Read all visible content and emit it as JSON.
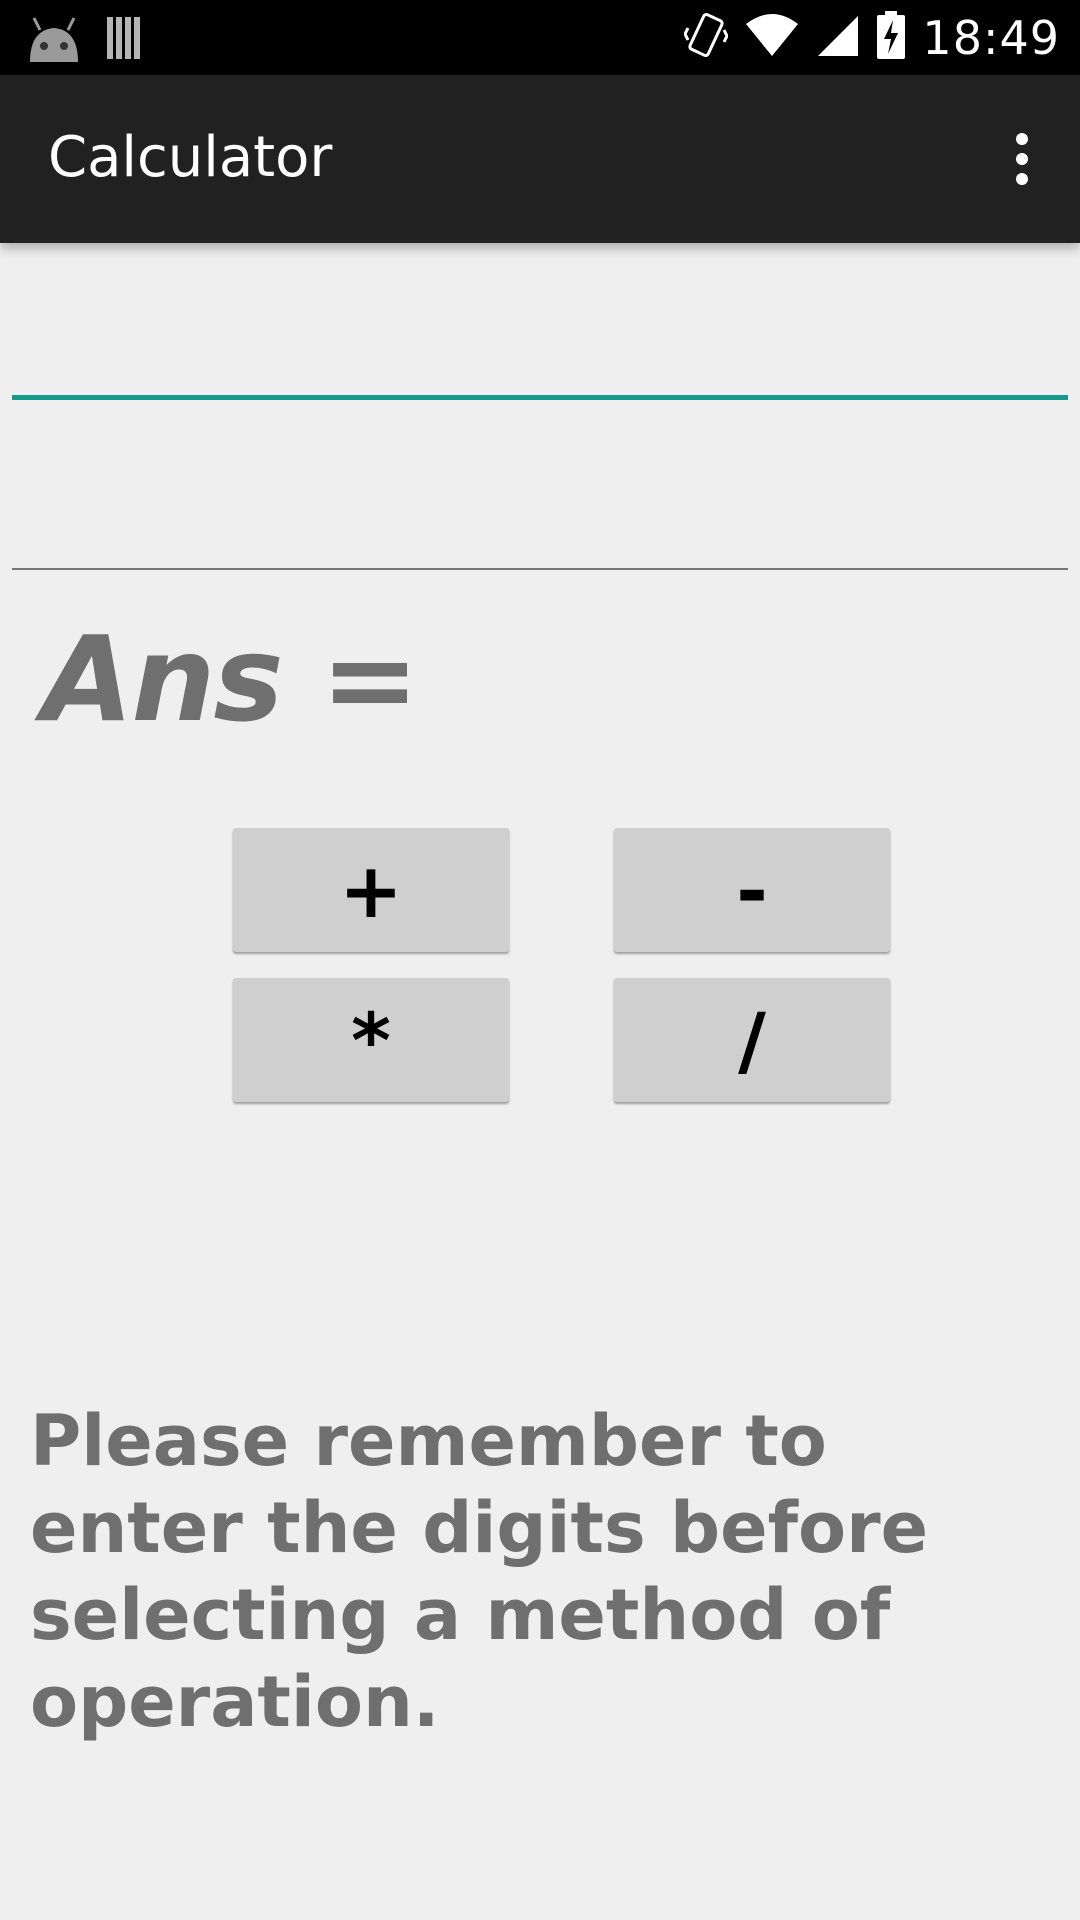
{
  "status_bar": {
    "time": "18:49",
    "icons": [
      "android-debug-icon",
      "storage-icon",
      "vibrate-icon",
      "wifi-icon",
      "signal-icon",
      "battery-charging-icon"
    ]
  },
  "app_bar": {
    "title": "Calculator",
    "overflow_icon": "more-vert-icon"
  },
  "inputs": {
    "first_value": "",
    "second_value": ""
  },
  "result": {
    "label": "Ans ="
  },
  "operators": {
    "add": "+",
    "subtract": "-",
    "multiply": "*",
    "divide": "/"
  },
  "hint": {
    "text": "Please remember to enter the digits before selecting a method of operation."
  },
  "colors": {
    "accent": "#159a8c",
    "app_bar": "#212121",
    "background": "#efefef",
    "button": "#cfcfcf",
    "muted_text": "#6f6f6f"
  }
}
